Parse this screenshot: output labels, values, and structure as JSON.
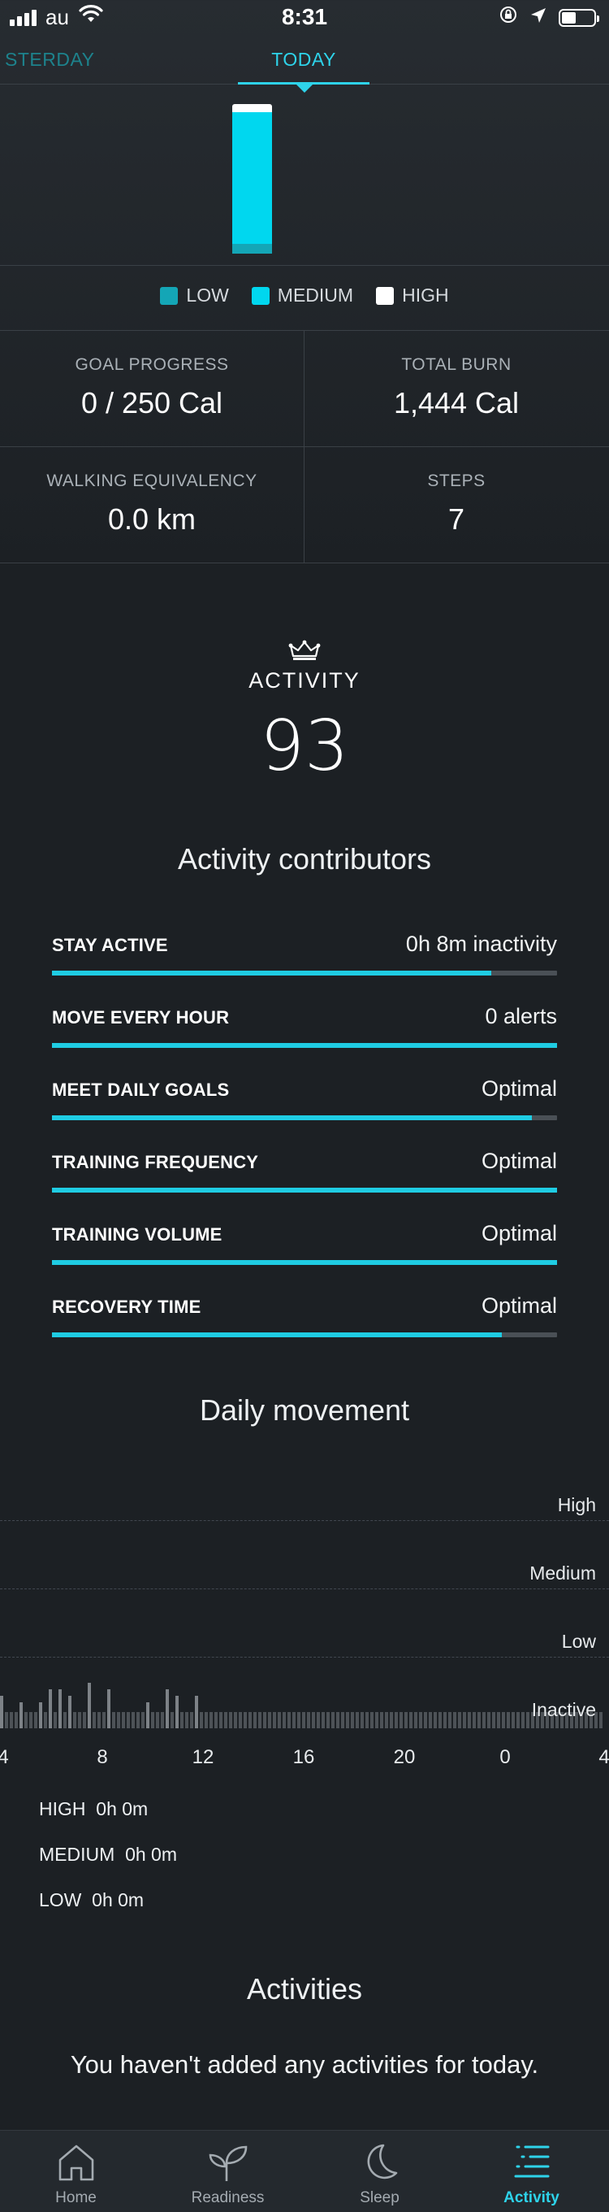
{
  "status_bar": {
    "carrier": "au",
    "time": "8:31",
    "icons": [
      "signal-icon",
      "wifi-icon",
      "orientation-lock-icon",
      "location-icon",
      "battery-icon"
    ],
    "battery_level": 0.45
  },
  "tabs": [
    {
      "label": "STERDAY",
      "active": false
    },
    {
      "label": "TODAY",
      "active": true
    }
  ],
  "intensity_chart": {
    "legend": [
      {
        "label": "LOW",
        "color": "#14a6b6"
      },
      {
        "label": "MEDIUM",
        "color": "#00d7ef"
      },
      {
        "label": "HIGH",
        "color": "#ffffff"
      }
    ]
  },
  "stats": {
    "goal_progress": {
      "label": "GOAL PROGRESS",
      "value": "0 / 250 Cal"
    },
    "total_burn": {
      "label": "TOTAL BURN",
      "value": "1,444 Cal"
    },
    "walking_equivalency": {
      "label": "WALKING EQUIVALENCY",
      "value": "0.0 km"
    },
    "steps": {
      "label": "STEPS",
      "value": "7"
    }
  },
  "activity_score": {
    "label": "ACTIVITY",
    "value": "93",
    "icon": "crown-icon"
  },
  "contributors": {
    "title": "Activity contributors",
    "items": [
      {
        "name": "STAY ACTIVE",
        "value": "0h 8m inactivity",
        "progress": 0.87
      },
      {
        "name": "MOVE EVERY HOUR",
        "value": "0 alerts",
        "progress": 1.0
      },
      {
        "name": "MEET DAILY GOALS",
        "value": "Optimal",
        "progress": 0.95
      },
      {
        "name": "TRAINING FREQUENCY",
        "value": "Optimal",
        "progress": 1.0
      },
      {
        "name": "TRAINING VOLUME",
        "value": "Optimal",
        "progress": 1.0
      },
      {
        "name": "RECOVERY TIME",
        "value": "Optimal",
        "progress": 0.89
      }
    ]
  },
  "daily_movement": {
    "title": "Daily movement",
    "levels": [
      "High",
      "Medium",
      "Low",
      "Inactive"
    ],
    "axis_labels": [
      "4",
      "8",
      "12",
      "16",
      "20",
      "0",
      "4"
    ],
    "totals": [
      {
        "label": "HIGH",
        "value": "0h 0m"
      },
      {
        "label": "MEDIUM",
        "value": "0h 0m"
      },
      {
        "label": "LOW",
        "value": "0h 0m"
      }
    ]
  },
  "activities": {
    "title": "Activities",
    "empty_message": "You haven't added any activities for today."
  },
  "nav": [
    {
      "label": "Home",
      "icon": "home-icon",
      "active": false
    },
    {
      "label": "Readiness",
      "icon": "sprout-icon",
      "active": false
    },
    {
      "label": "Sleep",
      "icon": "moon-icon",
      "active": false
    },
    {
      "label": "Activity",
      "icon": "activity-list-icon",
      "active": true
    }
  ],
  "colors": {
    "accent": "#2ed3ea",
    "bar_fill": "#1fcce3",
    "background": "#1c2024"
  }
}
